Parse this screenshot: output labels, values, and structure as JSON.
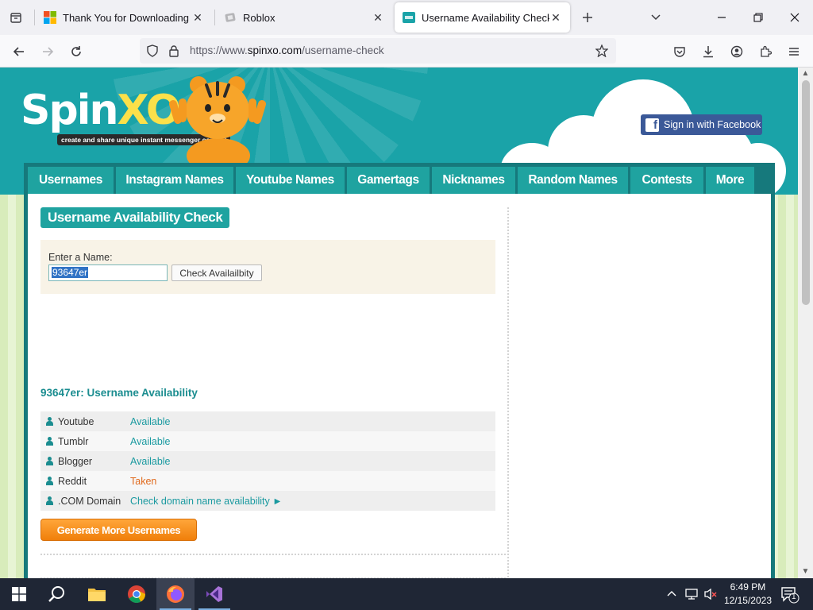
{
  "browser": {
    "tabs": [
      {
        "title": "Thank You for Downloading Vis",
        "favicon": "microsoft-icon"
      },
      {
        "title": "Roblox",
        "favicon": "roblox-icon"
      },
      {
        "title": "Username Availability Check",
        "favicon": "spinxo-icon"
      }
    ],
    "url_prefix": "https://www.",
    "url_host": "spinxo.com",
    "url_path": "/username-check"
  },
  "site": {
    "logo_main": "Spin",
    "logo_accent": "XO",
    "tagline": "create and share unique instant messenger content",
    "facebook_button": "Sign in with Facebook",
    "menu": [
      "Usernames",
      "Instagram Names",
      "Youtube Names",
      "Gamertags",
      "Nicknames",
      "Random Names",
      "Contests",
      "More"
    ]
  },
  "check": {
    "section_title": "Username Availability Check",
    "input_label": "Enter a Name:",
    "input_value": "93647er",
    "check_button": "Check Availailbity"
  },
  "results": {
    "title": "93647er: Username Availability",
    "rows": [
      {
        "site": "Youtube",
        "status": "Available"
      },
      {
        "site": "Tumblr",
        "status": "Available"
      },
      {
        "site": "Blogger",
        "status": "Available"
      },
      {
        "site": "Reddit",
        "status": "Taken"
      },
      {
        "site": ".COM Domain",
        "status": "Check domain name availability ►"
      }
    ],
    "generate_button": "Generate More Usernames"
  },
  "colors": {
    "teal": "#1fa3a0",
    "dark_teal": "#16797c",
    "taken": "#e0691c",
    "facebook": "#3b5998",
    "orange_button": "#f5921e"
  },
  "taskbar": {
    "time": "6:49 PM",
    "date": "12/15/2023",
    "notifications": "1"
  }
}
